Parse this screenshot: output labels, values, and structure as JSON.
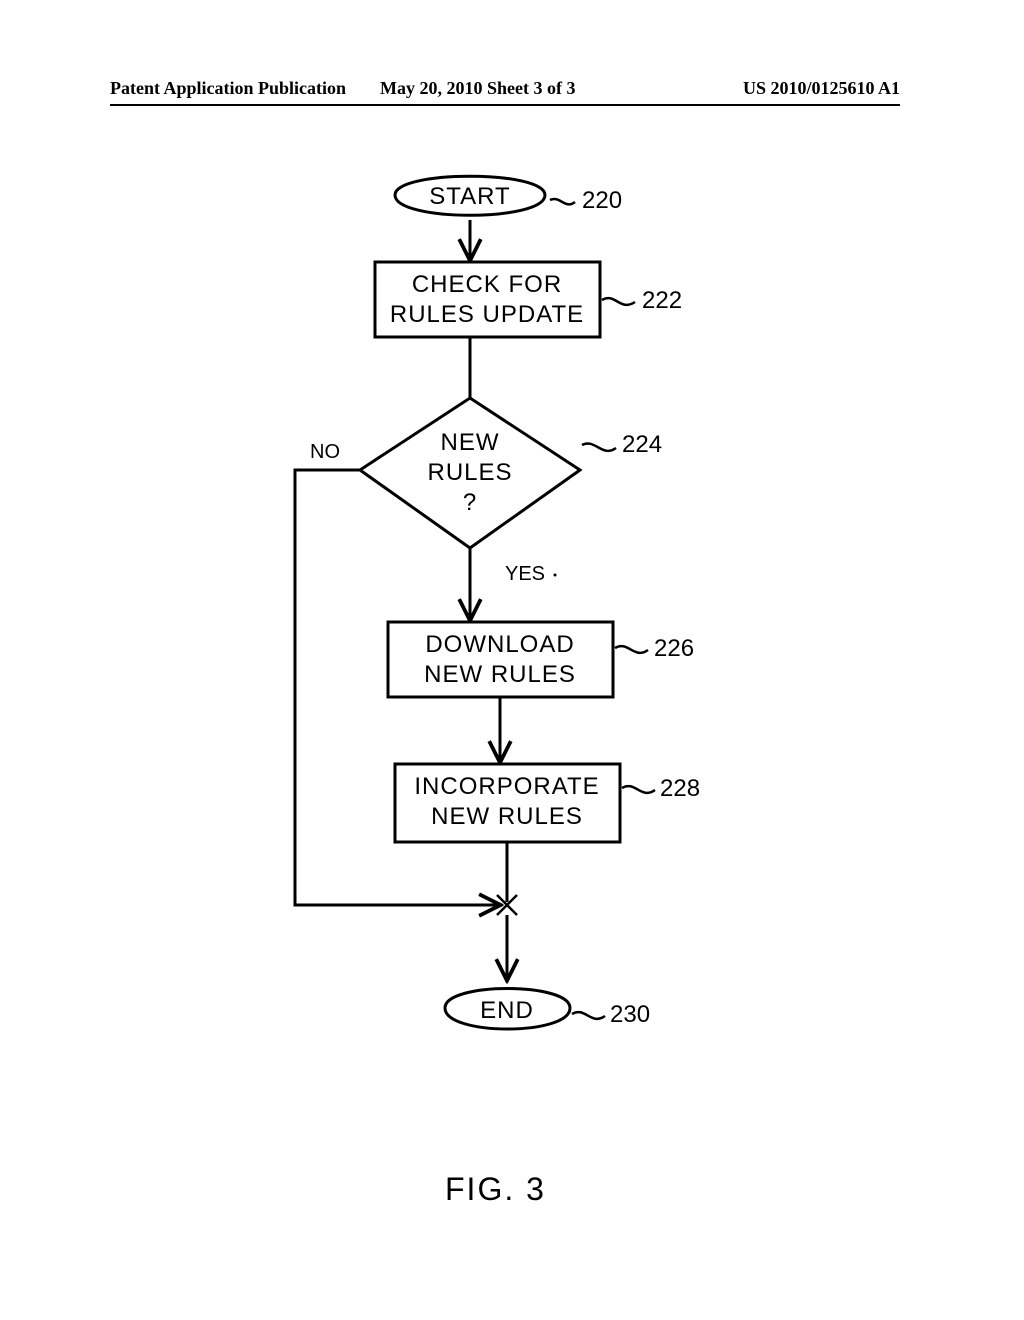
{
  "header": {
    "left": "Patent Application Publication",
    "center": "May 20, 2010  Sheet 3 of 3",
    "right": "US 2010/0125610 A1"
  },
  "nodes": {
    "start": {
      "label": "START",
      "ref": "220"
    },
    "check": {
      "line1": "CHECK  FOR",
      "line2": "RULES UPDATE",
      "ref": "222"
    },
    "decision": {
      "line1": "NEW",
      "line2": "RULES",
      "line3": "?",
      "ref": "224",
      "yes": "YES",
      "no": "NO"
    },
    "download": {
      "line1": "DOWNLOAD",
      "line2": "NEW RULES",
      "ref": "226"
    },
    "incorporate": {
      "line1": "INCORPORATE",
      "line2": "NEW RULES",
      "ref": "228"
    },
    "end": {
      "label": "END",
      "ref": "230"
    }
  },
  "caption": "FIG. 3"
}
